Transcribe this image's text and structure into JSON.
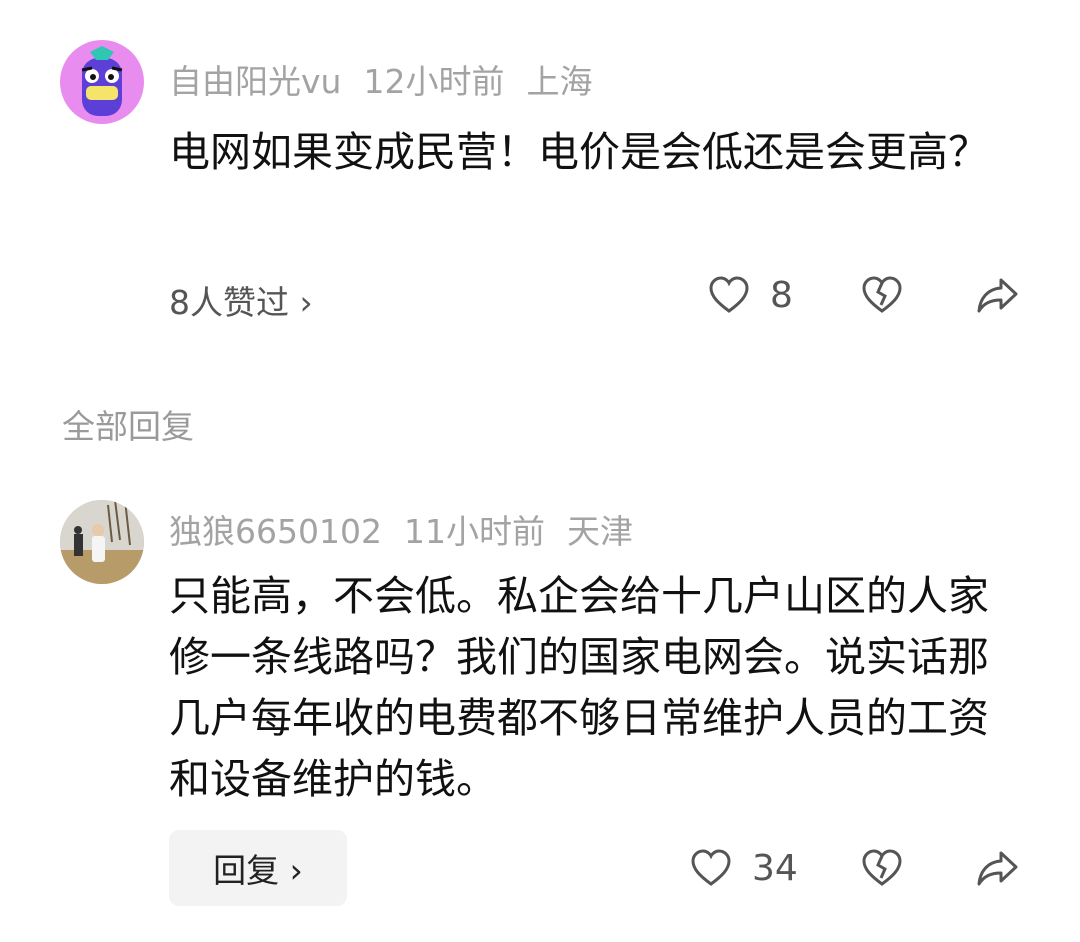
{
  "post": {
    "username": "自由阳光vu",
    "time": "12小时前",
    "location": "上海",
    "content": "电网如果变成民营！电价是会低还是会更高？",
    "liked_by": "8人赞过 ›",
    "like_count": "8",
    "icons": [
      "heart-icon",
      "broken-heart-icon",
      "share-arrow-icon"
    ]
  },
  "section_title": "全部回复",
  "reply": {
    "username": "独狼6650102",
    "time": "11小时前",
    "location": "天津",
    "content": "只能高，不会低。私企会给十几户山区的人家修一条线路吗？我们的国家电网会。说实话那几户每年收的电费都不够日常维护人员的工资和设备维护的钱。",
    "reply_button": "回复 ›",
    "like_count": "34",
    "icons": [
      "heart-icon",
      "broken-heart-icon",
      "share-arrow-icon"
    ]
  },
  "colors": {
    "meta_text": "#a3a3a3",
    "icon_stroke": "#555555",
    "avatar_bg": "#e98cf0"
  }
}
